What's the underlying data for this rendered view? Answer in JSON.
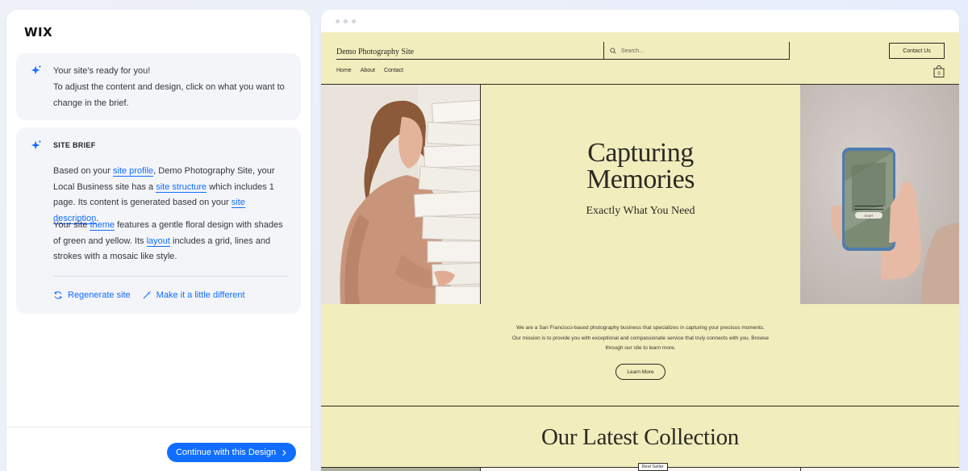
{
  "brand": {
    "logo": "WIX"
  },
  "assistant": {
    "welcome": {
      "line1": "Your site's ready for you!",
      "line2": "To adjust the content and design, click on what you want to change in the brief."
    },
    "brief": {
      "title": "SITE BRIEF",
      "p1": {
        "t1": "Based on your ",
        "link1": "site profile",
        "t2": ", Demo Photography Site, your Local Business site has a ",
        "link2": "site structure",
        "t3": " which includes 1 page. Its content is generated based on your ",
        "link3": "site description",
        "t4": "."
      },
      "p2": {
        "t1": "Your site ",
        "link1": "theme",
        "t2": " features a gentle floral design with shades of green and yellow. Its ",
        "link2": "layout",
        "t3": " includes a grid, lines and strokes with a mosaic like style."
      },
      "actions": {
        "regenerate": "Regenerate site",
        "different": "Make it a little different"
      }
    },
    "continue_label": "Continue with this Design"
  },
  "site": {
    "title": "Demo Photography Site",
    "search_placeholder": "Search...",
    "contact_label": "Contact Us",
    "nav": [
      "Home",
      "About",
      "Contact"
    ],
    "cart_count": "0",
    "hero": {
      "title_line1": "Capturing",
      "title_line2": "Memories",
      "subtitle": "Exactly What You Need"
    },
    "about_text": "We are a San Francisco-based photography business that specializes in capturing your precious moments. Our mission is to provide you with exceptional and compassionate service that truly connects with you. Browse through our site to learn more.",
    "learn_more_label": "Learn More",
    "collection_title": "Our Latest Collection",
    "badge": "Best Seller",
    "phone_screen_label": "START"
  },
  "colors": {
    "accent": "#116dff",
    "site_background": "#f1edbd",
    "site_ink": "#2c2a23"
  },
  "icons": [
    "sparkle-icon",
    "refresh-icon",
    "magic-wand-icon",
    "chevron-right-icon",
    "search-icon",
    "shopping-bag-icon"
  ]
}
